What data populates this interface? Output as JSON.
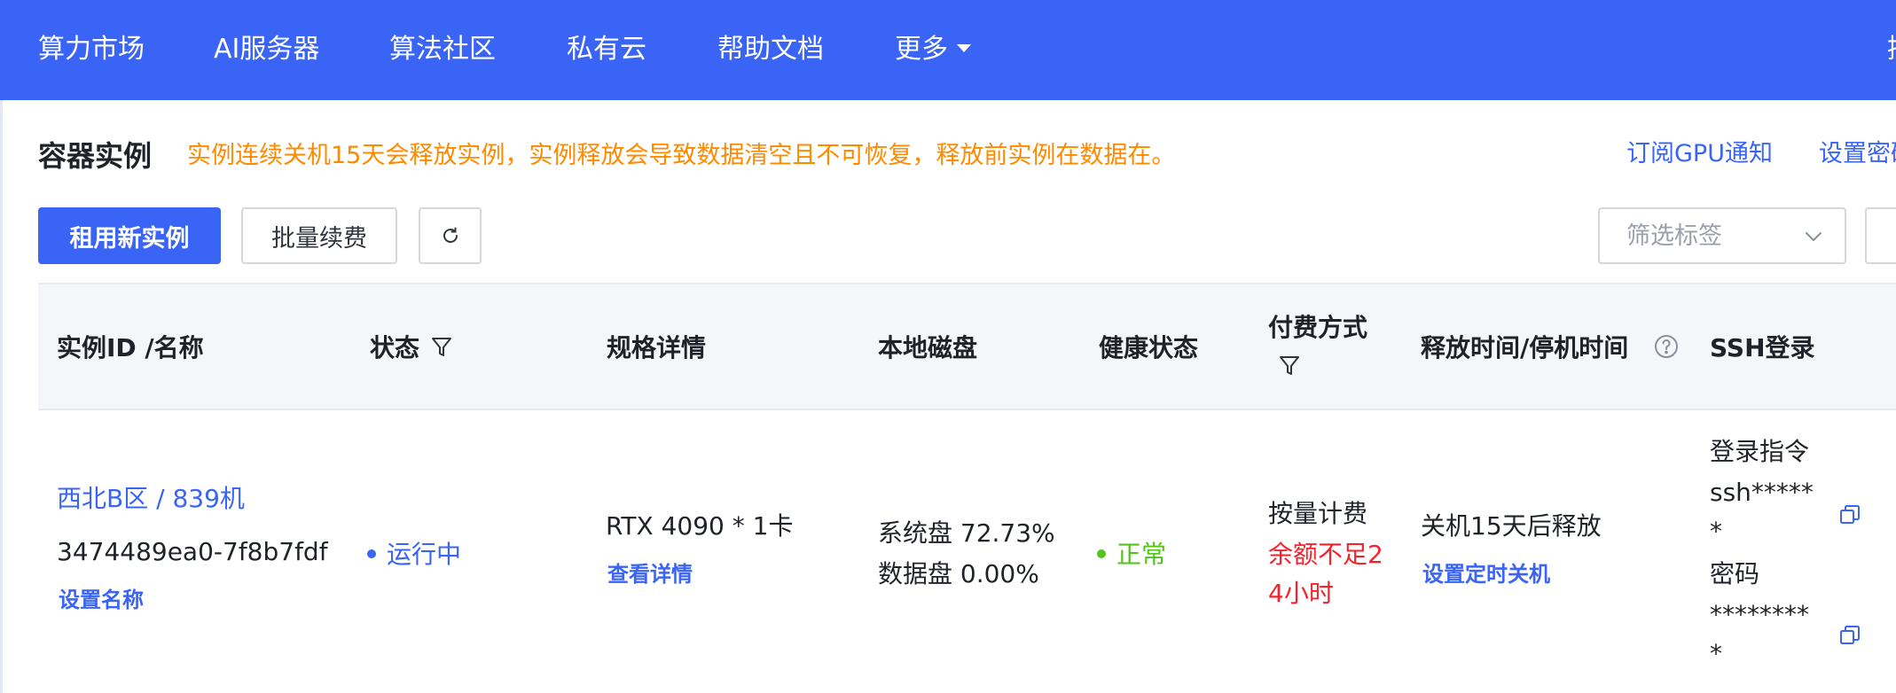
{
  "nav": {
    "items": [
      "算力市场",
      "AI服务器",
      "算法社区",
      "私有云",
      "帮助文档",
      "更多"
    ],
    "clipped_item": "控"
  },
  "header": {
    "title": "容器实例",
    "warning": "实例连续关机15天会释放实例，实例释放会导致数据清空且不可恢复，释放前实例在数据在。",
    "subscribe_gpu": "订阅GPU通知",
    "settings_clipped": "设置密码"
  },
  "toolbar": {
    "rent_new": "租用新实例",
    "batch_renew": "批量续费",
    "refresh_icon": "refresh-icon",
    "filter_tags_placeholder": "筛选标签"
  },
  "table": {
    "columns": {
      "id_name": "实例ID /名称",
      "status": "状态",
      "spec": "规格详情",
      "disk": "本地磁盘",
      "health": "健康状态",
      "billing": "付费方式",
      "release": "释放时间/停机时间",
      "ssh": "SSH登录"
    },
    "rows": [
      {
        "region_name": "西北B区 / 839机",
        "instance_id": "3474489ea0-7f8b7fdf",
        "set_name": "设置名称",
        "status": "运行中",
        "spec": "RTX 4090 * 1卡",
        "spec_details": "查看详情",
        "system_disk": "系统盘 72.73%",
        "data_disk": "数据盘 0.00%",
        "health": "正常",
        "billing": "按量计费",
        "balance_warning_line1": "余额不足2",
        "balance_warning_line2": "4小时",
        "release": "关机15天后释放",
        "set_shutdown": "设置定时关机",
        "login_cmd_label": "登录指令",
        "login_cmd_line1": "ssh*****",
        "login_cmd_line2": "*",
        "password_label": "密码",
        "password_line1": "********",
        "password_line2": "*"
      }
    ]
  },
  "colors": {
    "brand": "#3964f5",
    "warning": "#ff8a00",
    "danger": "#f5222d",
    "success": "#52c41a"
  }
}
